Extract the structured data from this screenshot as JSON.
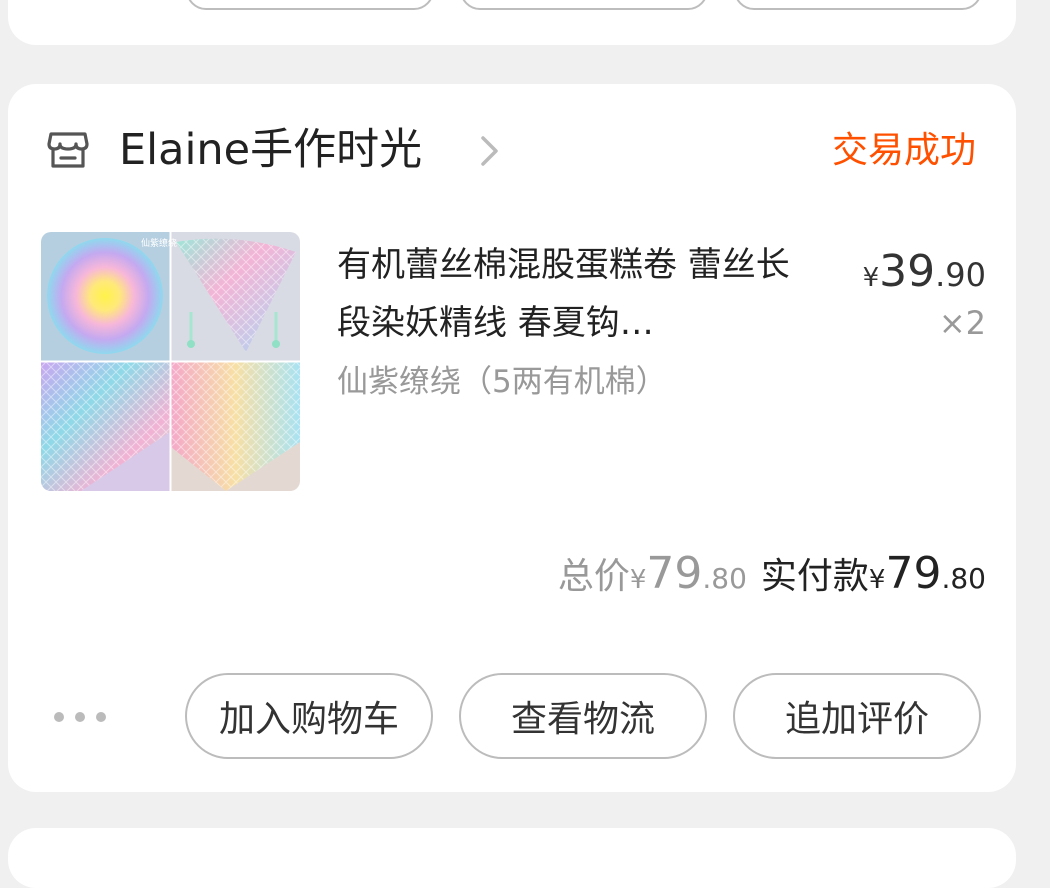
{
  "shop": {
    "name": "Elaine手作时光",
    "status": "交易成功"
  },
  "product": {
    "title": "有机蕾丝棉混股蛋糕卷 蕾丝长段染妖精线 春夏钩…",
    "spec": "仙紫缭绕（5两有机棉）",
    "image_caption": "仙紫缭绕",
    "price_currency": "¥",
    "price_int": "39",
    "price_dec": ".90",
    "quantity": "×2"
  },
  "totals": {
    "total_label": "总价",
    "total_currency": "¥",
    "total_int": "79",
    "total_dec": ".80",
    "paid_label": "实付款",
    "paid_currency": "¥",
    "paid_int": "79",
    "paid_dec": ".80"
  },
  "actions": {
    "add_to_cart": "加入购物车",
    "view_logistics": "查看物流",
    "add_review": "追加评价"
  },
  "colors": {
    "status": "#ff5000",
    "background": "#f0f0f0"
  },
  "icons": [
    "store-icon",
    "chevron-right-icon",
    "more-dots-icon"
  ]
}
